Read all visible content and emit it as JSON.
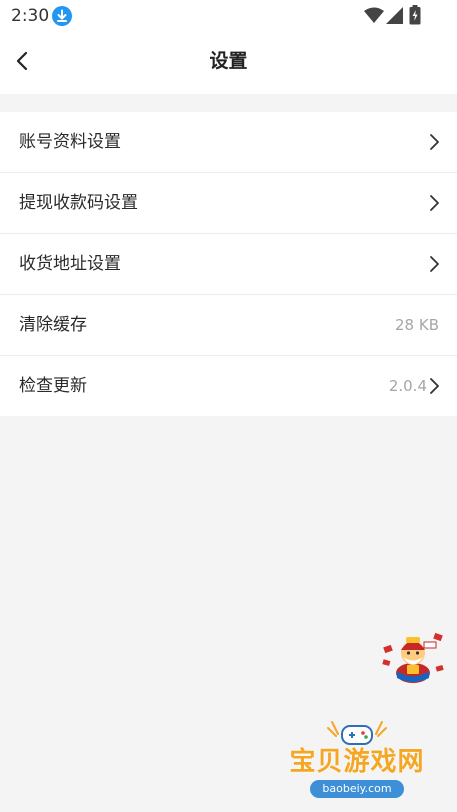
{
  "status_bar": {
    "time": "2:30",
    "icons": [
      "download-icon",
      "wifi-icon",
      "signal-icon",
      "battery-icon"
    ]
  },
  "header": {
    "title": "设置",
    "back_icon": "chevron-left-icon"
  },
  "menu": [
    {
      "id": "account-profile",
      "label": "账号资料设置",
      "value": "",
      "chevron": true
    },
    {
      "id": "withdraw-qr",
      "label": "提现收款码设置",
      "value": "",
      "chevron": true
    },
    {
      "id": "shipping-address",
      "label": "收货地址设置",
      "value": "",
      "chevron": true
    },
    {
      "id": "clear-cache",
      "label": "清除缓存",
      "value": "28 KB",
      "chevron": false
    },
    {
      "id": "check-update",
      "label": "检查更新",
      "value": "2.0.4",
      "chevron": true
    }
  ],
  "watermark": {
    "title": "宝贝游戏网",
    "domain": "baobeiy.com"
  },
  "colors": {
    "background": "#f4f4f4",
    "surface": "#ffffff",
    "text_primary": "#2a2a2a",
    "text_secondary": "#a6a6a6",
    "download_badge": "#2196f3",
    "watermark": "#f5a623"
  }
}
